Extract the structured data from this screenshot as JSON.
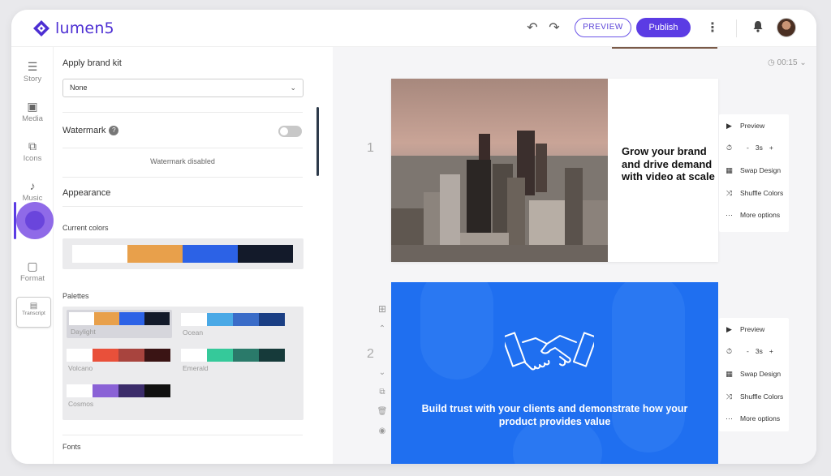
{
  "header": {
    "logo_text": "lumen5",
    "preview_label": "PREVIEW",
    "publish_label": "Publish"
  },
  "leftnav": {
    "items": [
      {
        "label": "Story",
        "icon": "story-icon"
      },
      {
        "label": "Media",
        "icon": "media-icon"
      },
      {
        "label": "Icons",
        "icon": "icons-icon"
      },
      {
        "label": "Music",
        "icon": "music-icon"
      },
      {
        "label": "Format",
        "icon": "format-icon"
      }
    ],
    "transcript_label": "Transcript"
  },
  "panel": {
    "brand_kit_label": "Apply brand kit",
    "brand_kit_value": "None",
    "watermark_label": "Watermark",
    "watermark_status": "Watermark disabled",
    "appearance_label": "Appearance",
    "current_colors_label": "Current colors",
    "current_colors": [
      "#ffffff",
      "#e8a04b",
      "#2c62e6",
      "#131a2a"
    ],
    "palettes_label": "Palettes",
    "palettes": [
      {
        "name": "Daylight",
        "colors": [
          "#ffffff",
          "#e8a04b",
          "#2c62e6",
          "#131a2a"
        ],
        "selected": true
      },
      {
        "name": "Ocean",
        "colors": [
          "#ffffff",
          "#4aa9e6",
          "#3a6cc8",
          "#1b3f84"
        ],
        "selected": false
      },
      {
        "name": "Volcano",
        "colors": [
          "#ffffff",
          "#e9503a",
          "#a8443e",
          "#3a1414"
        ],
        "selected": false
      },
      {
        "name": "Emerald",
        "colors": [
          "#ffffff",
          "#35c99a",
          "#2a7a6a",
          "#163a3a"
        ],
        "selected": false
      },
      {
        "name": "Cosmos",
        "colors": [
          "#ffffff",
          "#8a62d6",
          "#3b2c6a",
          "#111111"
        ],
        "selected": false
      }
    ],
    "fonts_label": "Fonts"
  },
  "canvas": {
    "timer": "00:15",
    "scenes": [
      {
        "number": "1",
        "text": "Grow your brand and drive demand with video at scale",
        "duration": "3s"
      },
      {
        "number": "2",
        "text": "Build trust with your clients and demonstrate how your product provides value",
        "duration": "3s"
      }
    ],
    "menu": {
      "preview": "Preview",
      "minus": "-",
      "plus": "+",
      "swap_design": "Swap Design",
      "shuffle_colors": "Shuffle Colors",
      "more_options": "More options"
    }
  },
  "colors": {
    "brand": "#5b3ce4",
    "scene2_bg": "#1f6ff0"
  }
}
